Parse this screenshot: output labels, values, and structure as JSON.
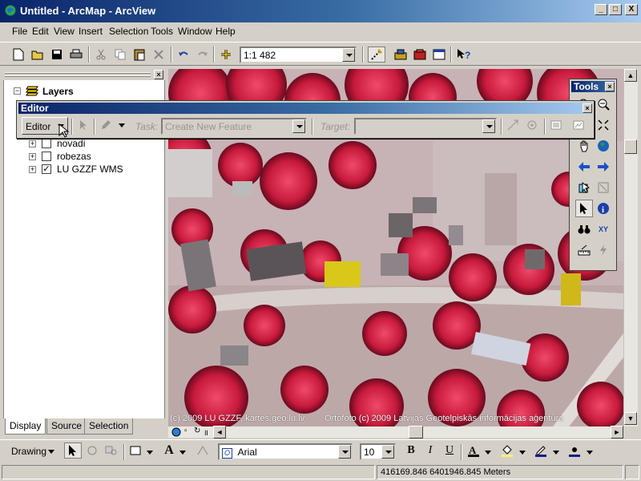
{
  "window": {
    "title": "Untitled - ArcMap - ArcView",
    "minimize_label": "_",
    "maximize_label": "□",
    "close_label": "X"
  },
  "menu": [
    "File",
    "Edit",
    "View",
    "Insert",
    "Selection",
    "Tools",
    "Window",
    "Help"
  ],
  "standard_toolbar": {
    "scale_value": "1:1 482"
  },
  "toc": {
    "root_label": "Layers",
    "layers": [
      {
        "label": "novadi",
        "checked": false
      },
      {
        "label": "robezas",
        "checked": false
      },
      {
        "label": "LU GZZF WMS",
        "checked": true
      }
    ],
    "tabs": [
      "Display",
      "Source",
      "Selection"
    ]
  },
  "editor_toolbar": {
    "title": "Editor",
    "menu_label": "Editor",
    "task_label": "Task:",
    "task_value": "Create New Feature",
    "target_label": "Target:",
    "target_value": ""
  },
  "tools_palette": {
    "title": "Tools"
  },
  "map": {
    "credit_left": "(c) 2009 LU GZZF, kartes.geo.lu.lv",
    "credit_right": "Ortofoto (c) 2009 Latvijas Ģeotelpiskās informācijas aģentūra"
  },
  "drawing_toolbar": {
    "drawing_label": "Drawing",
    "font_value": "Arial",
    "size_value": "10",
    "bold": "B",
    "italic": "I",
    "underline": "U",
    "text_tool": "A"
  },
  "status": {
    "coordinates": "416169.846  6401946.845 Meters"
  },
  "colors": {
    "titlebar": "#0a246a",
    "face": "#d4d0c8",
    "map_vegetation": "#d8254a"
  }
}
